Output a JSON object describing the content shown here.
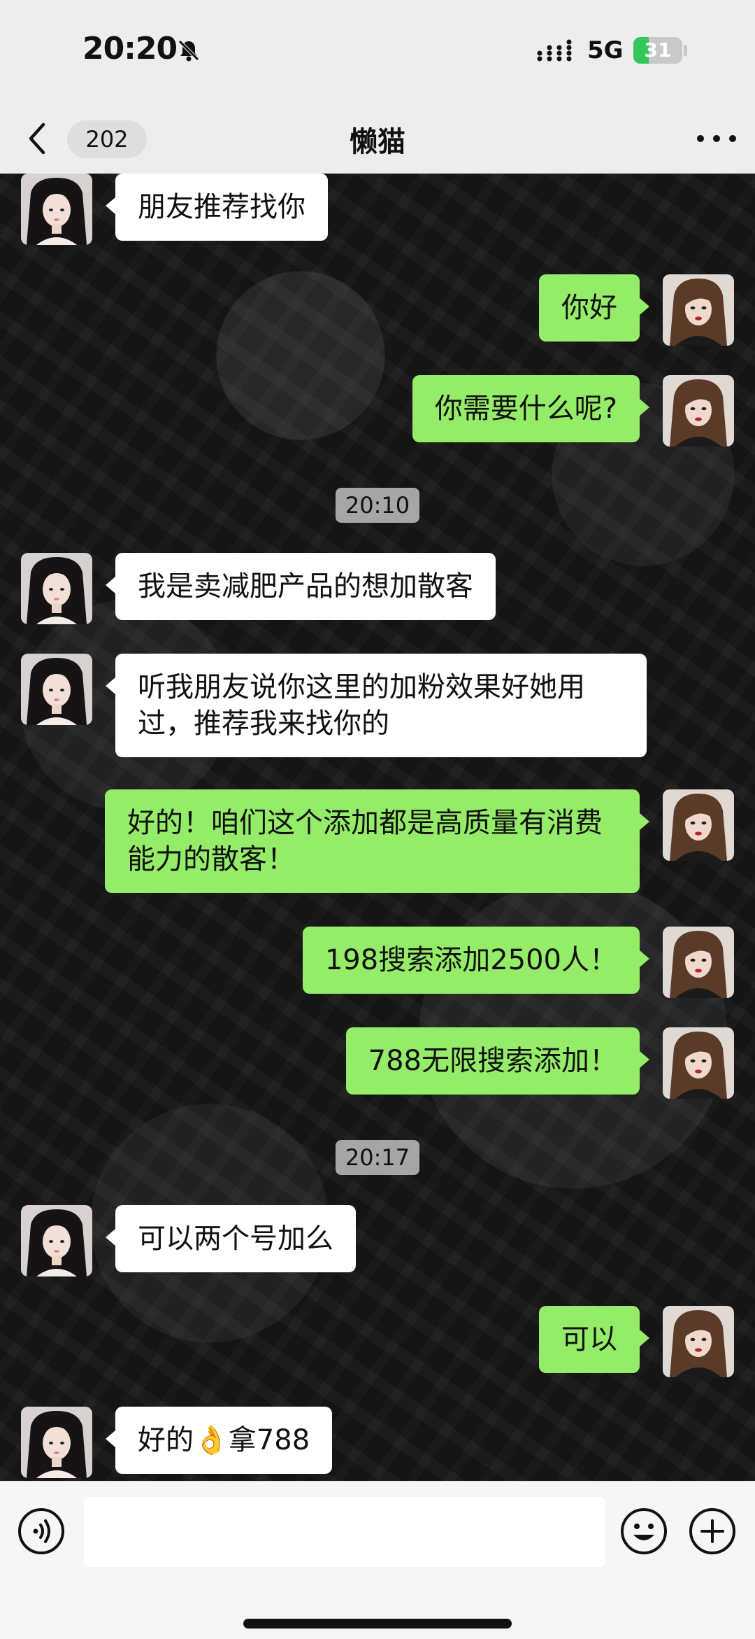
{
  "status_bar": {
    "time": "20:20",
    "network": "5G",
    "battery_level": "31",
    "battery_fill_fraction": 0.31,
    "battery_color": "#34c759"
  },
  "nav": {
    "back_icon": "chevron-left-icon",
    "unread_count": "202",
    "title": "懒猫",
    "more_icon": "more-horizontal-icon"
  },
  "colors": {
    "bubble_out": "#95ec69",
    "bubble_in": "#ffffff",
    "nav_bg": "#ededed"
  },
  "messages": [
    {
      "side": "in",
      "text": "朋友推荐找你"
    },
    {
      "side": "out",
      "text": "你好"
    },
    {
      "side": "out",
      "text": "你需要什么呢?"
    },
    {
      "type": "time",
      "text": "20:10"
    },
    {
      "side": "in",
      "text": "我是卖减肥产品的想加散客"
    },
    {
      "side": "in",
      "text": "听我朋友说你这里的加粉效果好她用过，推荐我来找你的"
    },
    {
      "side": "out",
      "text": "好的！咱们这个添加都是高质量有消费能力的散客！"
    },
    {
      "side": "out",
      "text": "198搜索添加2500人！"
    },
    {
      "side": "out",
      "text": "788无限搜索添加！"
    },
    {
      "type": "time",
      "text": "20:17"
    },
    {
      "side": "in",
      "text": "可以两个号加么"
    },
    {
      "side": "out",
      "text": "可以"
    },
    {
      "side": "in",
      "text": "好的👌拿788"
    }
  ],
  "input_bar": {
    "voice_icon": "voice-icon",
    "emoji_icon": "emoji-icon",
    "plus_icon": "plus-icon",
    "input_value": ""
  }
}
